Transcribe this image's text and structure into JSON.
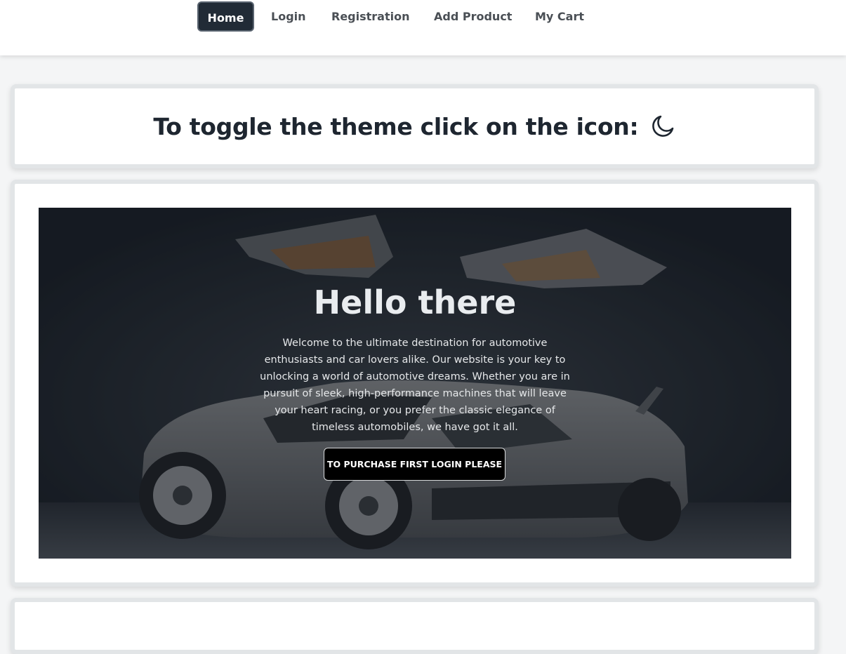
{
  "nav": {
    "items": [
      {
        "label": "Home",
        "active": true
      },
      {
        "label": "Login",
        "active": false
      },
      {
        "label": "Registration",
        "active": false
      },
      {
        "label": "Add Product",
        "active": false
      },
      {
        "label": "My Cart",
        "active": false
      }
    ]
  },
  "theme_toggle": {
    "heading": "To toggle the theme click on the icon:",
    "icon": "moon-icon"
  },
  "hero": {
    "title": "Hello there",
    "text": "Welcome to the ultimate destination for automotive enthusiasts and car lovers alike. Our website is your key to unlocking a world of automotive dreams. Whether you are in pursuit of sleek, high-performance machines that will leave your heart racing, or you prefer the classic elegance of timeless automobiles, we have got it all.",
    "button_label": "TO PURCHASE FIRST LOGIN PLEASE",
    "background_image": "sports car with gullwing doors open"
  },
  "colors": {
    "nav_active_bg": "#212b36",
    "heading_text": "#1e2630",
    "card_border": "#e2e5e7",
    "button_bg": "#000000"
  }
}
